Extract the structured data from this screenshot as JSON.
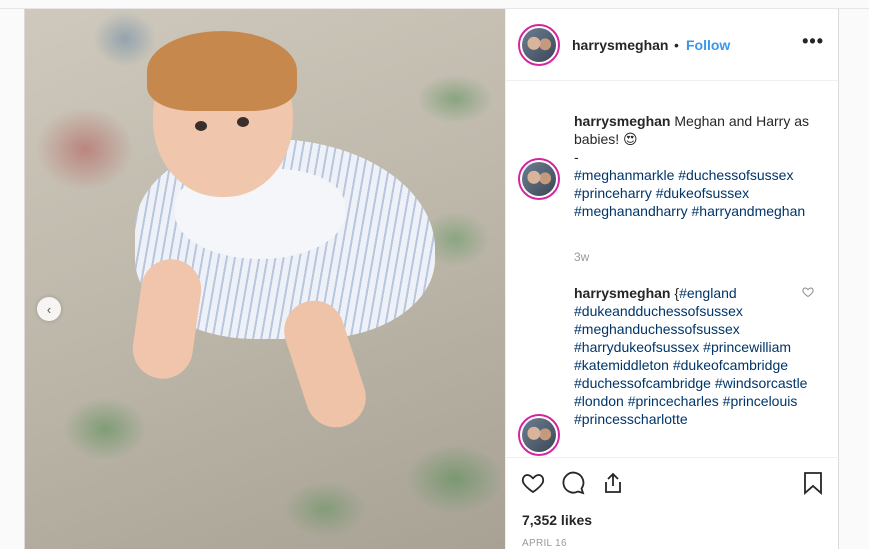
{
  "post": {
    "username": "harrysmeghan",
    "separator": "•",
    "follow_label": "Follow",
    "more_label": "•••",
    "prev_label": "‹"
  },
  "comments": [
    {
      "username": "harrysmeghan",
      "text": "Meghan and Harry as babies! 😍",
      "line2": "-",
      "hashtags": "#meghanmarkle #duchessofsussex #princeharry #dukeofsussex #meghanandharry #harryandmeghan",
      "time": "3w"
    },
    {
      "username": "harrysmeghan",
      "prefix": "{",
      "hashtags": "#england #dukeandduchessofsussex #meghanduchessofsussex #harrydukeofsussex #princewilliam #katemiddleton #dukeofcambridge #duchessofcambridge #windsorcastle #london #princecharles #princelouis #princesscharlotte"
    }
  ],
  "icons": {
    "like": "heart-icon",
    "comment": "comment-icon",
    "share": "share-icon",
    "save": "bookmark-icon",
    "comment_like": "small-heart-icon"
  },
  "likes": "7,352 likes",
  "date": "APRIL 16"
}
